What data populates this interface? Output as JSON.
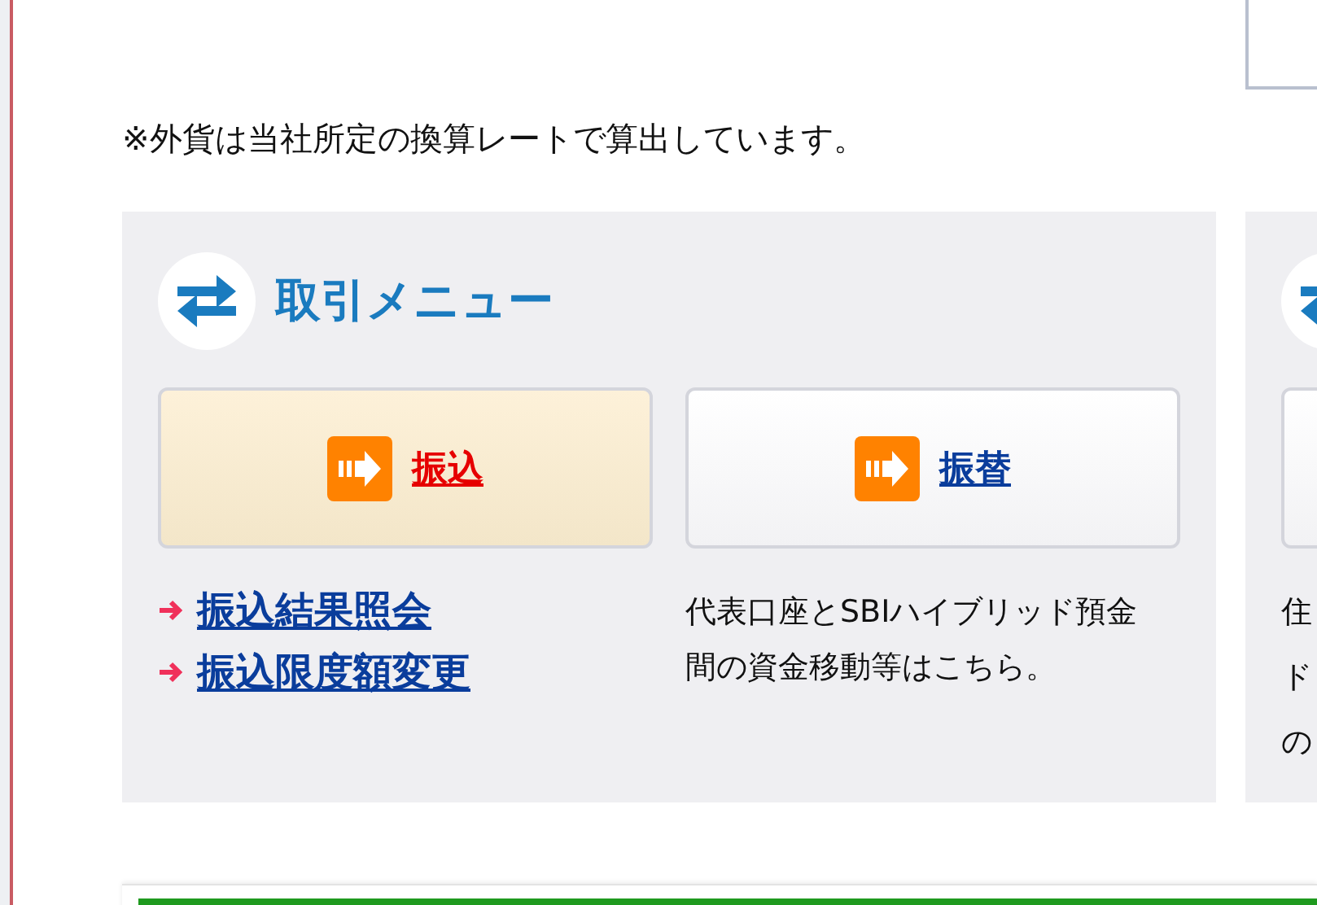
{
  "note": "※外貨は当社所定の換算レートで算出しています。",
  "panels": [
    {
      "title": "取引メニュー",
      "buttons": [
        {
          "label": "振込",
          "selected": true
        },
        {
          "label": "振替",
          "selected": false
        }
      ],
      "links": [
        "振込結果照会",
        "振込限度額変更"
      ],
      "description": [
        "代表口座とSBIハイブリッド預金間の資金移動等はこちら。"
      ]
    },
    {
      "buttons": [
        {
          "selected": false
        }
      ],
      "description": [
        "住",
        "ド",
        "の"
      ]
    }
  ]
}
